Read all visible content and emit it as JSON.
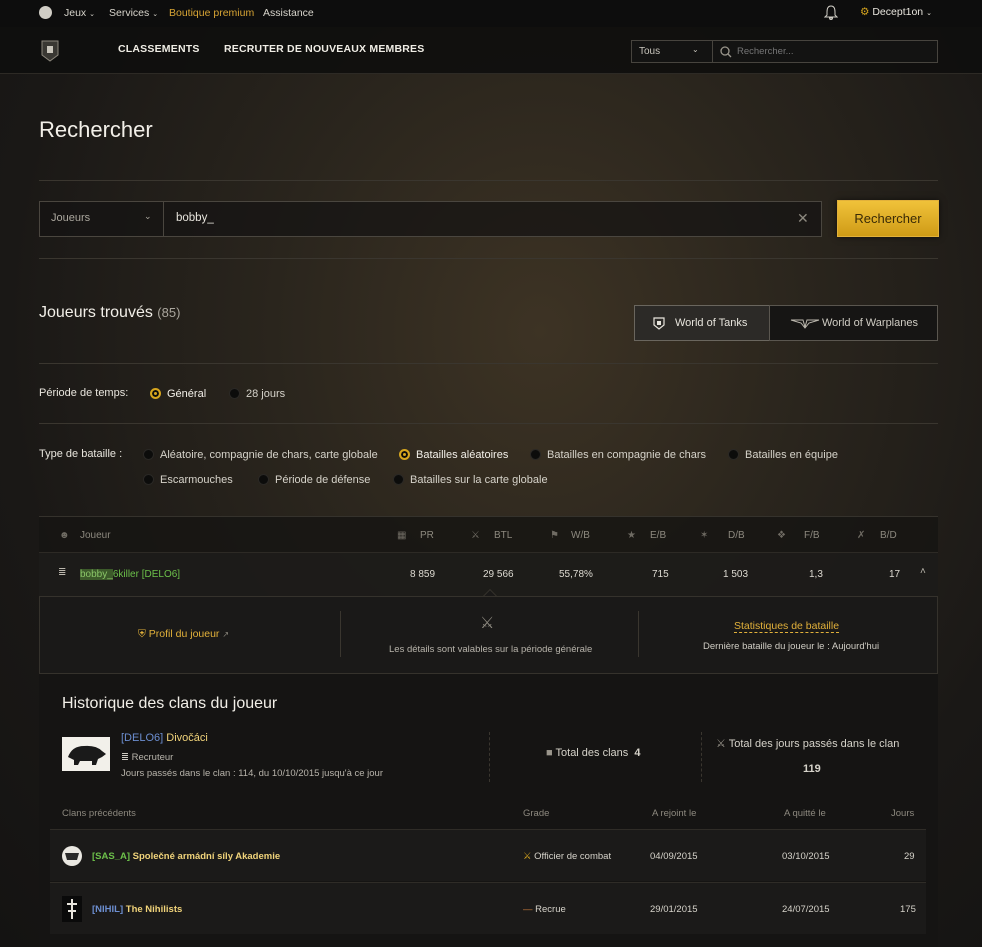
{
  "topbar": {
    "jeux": "Jeux",
    "services": "Services",
    "boutique": "Boutique premium",
    "assistance": "Assistance",
    "user": "Decept1on"
  },
  "nav": {
    "classements": "CLASSEMENTS",
    "recruter": "RECRUTER DE NOUVEAUX MEMBRES",
    "scope": "Tous",
    "search_placeholder": "Rechercher..."
  },
  "page": {
    "title": "Rechercher"
  },
  "search": {
    "type": "Joueurs",
    "value": "bobby_",
    "button": "Rechercher"
  },
  "results": {
    "heading": "Joueurs trouvés",
    "count": "(85)",
    "tab_tanks": "World of Tanks",
    "tab_planes": "World of Warplanes"
  },
  "period": {
    "label": "Période de temps:",
    "options": [
      "Général",
      "28 jours"
    ],
    "selected": 0
  },
  "battle": {
    "label": "Type de bataille :",
    "options": [
      "Aléatoire, compagnie de chars, carte globale",
      "Batailles aléatoires",
      "Batailles en compagnie de chars",
      "Batailles en équipe",
      "Escarmouches",
      "Période de défense",
      "Batailles sur la carte globale"
    ],
    "selected": 1
  },
  "table": {
    "headers": [
      "Joueur",
      "PR",
      "BTL",
      "W/B",
      "E/B",
      "D/B",
      "F/B",
      "B/D"
    ],
    "row": {
      "name_hl": "bobby_",
      "name_rest": "6killer [DELO6]",
      "pr": "8 859",
      "btl": "29 566",
      "wb": "55,78%",
      "eb": "715",
      "db": "1 503",
      "fb": "1,3",
      "bd": "17"
    }
  },
  "details": {
    "profile": "Profil du joueur",
    "note": "Les détails sont valables sur la période générale",
    "stats": "Statistiques de bataille",
    "last_battle": "Dernière bataille du joueur le : Aujourd'hui"
  },
  "clan_history": {
    "title": "Historique des clans du joueur",
    "current": {
      "tag": "[DELO6]",
      "name": "Divočáci",
      "role": "Recruteur",
      "days": "Jours passés dans le clan : 114, du 10/10/2015 jusqu'à ce jour"
    },
    "total_clans_label": "Total des clans",
    "total_clans": "4",
    "total_days_label": "Total des jours passés dans le clan",
    "total_days": "119",
    "columns": [
      "Clans précédents",
      "Grade",
      "A rejoint le",
      "A quitté le",
      "Jours"
    ],
    "rows": [
      {
        "tag": "[SAS_A]",
        "name": "Společné armádní síly Akademie",
        "grade": "Officier de combat",
        "joined": "04/09/2015",
        "left": "03/10/2015",
        "days": "29"
      },
      {
        "tag": "[NIHIL]",
        "name": "The Nihilists",
        "grade": "Recrue",
        "joined": "29/01/2015",
        "left": "24/07/2015",
        "days": "175"
      }
    ]
  },
  "colors": {
    "accent": "#d6a51e",
    "tag_green": "#6cc04a",
    "name_yellow": "#f0d37a"
  }
}
